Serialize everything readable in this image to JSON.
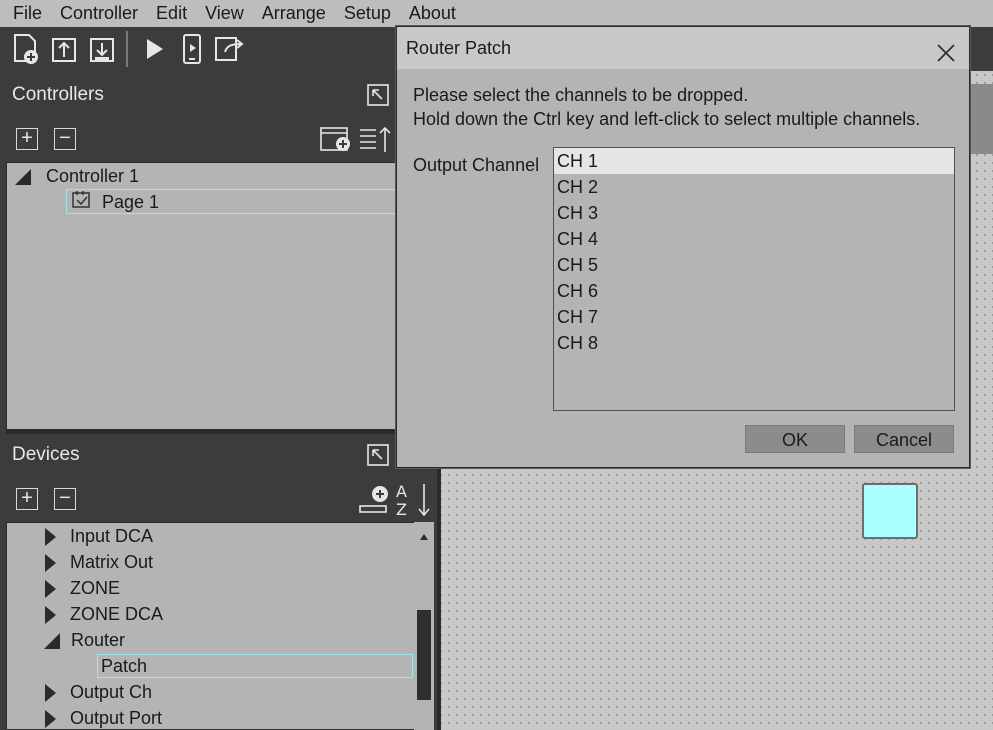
{
  "menu": [
    "File",
    "Controller",
    "Edit",
    "View",
    "Arrange",
    "Setup",
    "About"
  ],
  "toolbar": {
    "icons": [
      "new-project-icon",
      "upload-icon",
      "save-icon",
      "play-icon",
      "device-sync-icon",
      "export-icon"
    ]
  },
  "controllers_panel": {
    "title": "Controllers",
    "tree": {
      "controller": "Controller 1",
      "page": "Page 1"
    }
  },
  "devices_panel": {
    "title": "Devices",
    "items": [
      {
        "label": "Input DCA",
        "expanded": false
      },
      {
        "label": "Matrix Out",
        "expanded": false
      },
      {
        "label": "ZONE",
        "expanded": false
      },
      {
        "label": "ZONE DCA",
        "expanded": false
      },
      {
        "label": "Router",
        "expanded": true
      },
      {
        "label": "Patch",
        "child": true,
        "selected": true
      },
      {
        "label": "Output Ch",
        "expanded": false
      },
      {
        "label": "Output Port",
        "expanded": false
      }
    ]
  },
  "dialog": {
    "title": "Router Patch",
    "message_line1": "Please select the channels to be dropped.",
    "message_line2": "Hold down the Ctrl key and left-click to select multiple channels.",
    "output_label": "Output Channel",
    "channels": [
      "CH 1",
      "CH 2",
      "CH 3",
      "CH 4",
      "CH 5",
      "CH 6",
      "CH 7",
      "CH 8"
    ],
    "selected_index": 0,
    "ok_label": "OK",
    "cancel_label": "Cancel"
  },
  "colors": {
    "accent_selection": "#aaffff",
    "dark_panel": "#3c3c3c",
    "light_panel": "#b4b4b4"
  }
}
